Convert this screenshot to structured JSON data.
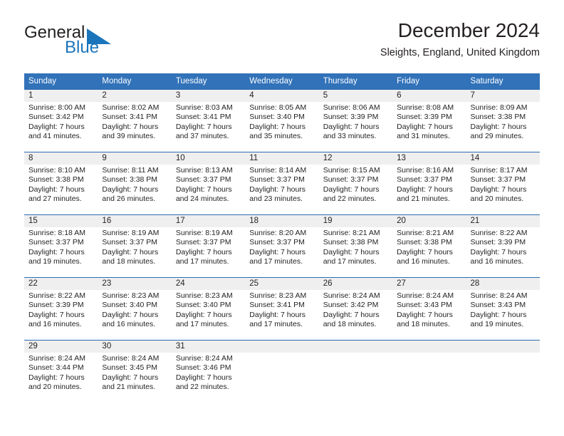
{
  "brand": {
    "name_part1": "General",
    "name_part2": "Blue",
    "accent_color": "#1b75bb"
  },
  "header": {
    "title": "December 2024",
    "subtitle": "Sleights, England, United Kingdom"
  },
  "theme": {
    "header_row_bg": "#3172b9",
    "daynum_band_bg": "#efefef",
    "rule_color": "#2a6cb3"
  },
  "weekdays": [
    "Sunday",
    "Monday",
    "Tuesday",
    "Wednesday",
    "Thursday",
    "Friday",
    "Saturday"
  ],
  "weeks": [
    [
      {
        "day": "1",
        "sunrise": "Sunrise: 8:00 AM",
        "sunset": "Sunset: 3:42 PM",
        "daylight1": "Daylight: 7 hours",
        "daylight2": "and 41 minutes."
      },
      {
        "day": "2",
        "sunrise": "Sunrise: 8:02 AM",
        "sunset": "Sunset: 3:41 PM",
        "daylight1": "Daylight: 7 hours",
        "daylight2": "and 39 minutes."
      },
      {
        "day": "3",
        "sunrise": "Sunrise: 8:03 AM",
        "sunset": "Sunset: 3:41 PM",
        "daylight1": "Daylight: 7 hours",
        "daylight2": "and 37 minutes."
      },
      {
        "day": "4",
        "sunrise": "Sunrise: 8:05 AM",
        "sunset": "Sunset: 3:40 PM",
        "daylight1": "Daylight: 7 hours",
        "daylight2": "and 35 minutes."
      },
      {
        "day": "5",
        "sunrise": "Sunrise: 8:06 AM",
        "sunset": "Sunset: 3:39 PM",
        "daylight1": "Daylight: 7 hours",
        "daylight2": "and 33 minutes."
      },
      {
        "day": "6",
        "sunrise": "Sunrise: 8:08 AM",
        "sunset": "Sunset: 3:39 PM",
        "daylight1": "Daylight: 7 hours",
        "daylight2": "and 31 minutes."
      },
      {
        "day": "7",
        "sunrise": "Sunrise: 8:09 AM",
        "sunset": "Sunset: 3:38 PM",
        "daylight1": "Daylight: 7 hours",
        "daylight2": "and 29 minutes."
      }
    ],
    [
      {
        "day": "8",
        "sunrise": "Sunrise: 8:10 AM",
        "sunset": "Sunset: 3:38 PM",
        "daylight1": "Daylight: 7 hours",
        "daylight2": "and 27 minutes."
      },
      {
        "day": "9",
        "sunrise": "Sunrise: 8:11 AM",
        "sunset": "Sunset: 3:38 PM",
        "daylight1": "Daylight: 7 hours",
        "daylight2": "and 26 minutes."
      },
      {
        "day": "10",
        "sunrise": "Sunrise: 8:13 AM",
        "sunset": "Sunset: 3:37 PM",
        "daylight1": "Daylight: 7 hours",
        "daylight2": "and 24 minutes."
      },
      {
        "day": "11",
        "sunrise": "Sunrise: 8:14 AM",
        "sunset": "Sunset: 3:37 PM",
        "daylight1": "Daylight: 7 hours",
        "daylight2": "and 23 minutes."
      },
      {
        "day": "12",
        "sunrise": "Sunrise: 8:15 AM",
        "sunset": "Sunset: 3:37 PM",
        "daylight1": "Daylight: 7 hours",
        "daylight2": "and 22 minutes."
      },
      {
        "day": "13",
        "sunrise": "Sunrise: 8:16 AM",
        "sunset": "Sunset: 3:37 PM",
        "daylight1": "Daylight: 7 hours",
        "daylight2": "and 21 minutes."
      },
      {
        "day": "14",
        "sunrise": "Sunrise: 8:17 AM",
        "sunset": "Sunset: 3:37 PM",
        "daylight1": "Daylight: 7 hours",
        "daylight2": "and 20 minutes."
      }
    ],
    [
      {
        "day": "15",
        "sunrise": "Sunrise: 8:18 AM",
        "sunset": "Sunset: 3:37 PM",
        "daylight1": "Daylight: 7 hours",
        "daylight2": "and 19 minutes."
      },
      {
        "day": "16",
        "sunrise": "Sunrise: 8:19 AM",
        "sunset": "Sunset: 3:37 PM",
        "daylight1": "Daylight: 7 hours",
        "daylight2": "and 18 minutes."
      },
      {
        "day": "17",
        "sunrise": "Sunrise: 8:19 AM",
        "sunset": "Sunset: 3:37 PM",
        "daylight1": "Daylight: 7 hours",
        "daylight2": "and 17 minutes."
      },
      {
        "day": "18",
        "sunrise": "Sunrise: 8:20 AM",
        "sunset": "Sunset: 3:37 PM",
        "daylight1": "Daylight: 7 hours",
        "daylight2": "and 17 minutes."
      },
      {
        "day": "19",
        "sunrise": "Sunrise: 8:21 AM",
        "sunset": "Sunset: 3:38 PM",
        "daylight1": "Daylight: 7 hours",
        "daylight2": "and 17 minutes."
      },
      {
        "day": "20",
        "sunrise": "Sunrise: 8:21 AM",
        "sunset": "Sunset: 3:38 PM",
        "daylight1": "Daylight: 7 hours",
        "daylight2": "and 16 minutes."
      },
      {
        "day": "21",
        "sunrise": "Sunrise: 8:22 AM",
        "sunset": "Sunset: 3:39 PM",
        "daylight1": "Daylight: 7 hours",
        "daylight2": "and 16 minutes."
      }
    ],
    [
      {
        "day": "22",
        "sunrise": "Sunrise: 8:22 AM",
        "sunset": "Sunset: 3:39 PM",
        "daylight1": "Daylight: 7 hours",
        "daylight2": "and 16 minutes."
      },
      {
        "day": "23",
        "sunrise": "Sunrise: 8:23 AM",
        "sunset": "Sunset: 3:40 PM",
        "daylight1": "Daylight: 7 hours",
        "daylight2": "and 16 minutes."
      },
      {
        "day": "24",
        "sunrise": "Sunrise: 8:23 AM",
        "sunset": "Sunset: 3:40 PM",
        "daylight1": "Daylight: 7 hours",
        "daylight2": "and 17 minutes."
      },
      {
        "day": "25",
        "sunrise": "Sunrise: 8:23 AM",
        "sunset": "Sunset: 3:41 PM",
        "daylight1": "Daylight: 7 hours",
        "daylight2": "and 17 minutes."
      },
      {
        "day": "26",
        "sunrise": "Sunrise: 8:24 AM",
        "sunset": "Sunset: 3:42 PM",
        "daylight1": "Daylight: 7 hours",
        "daylight2": "and 18 minutes."
      },
      {
        "day": "27",
        "sunrise": "Sunrise: 8:24 AM",
        "sunset": "Sunset: 3:43 PM",
        "daylight1": "Daylight: 7 hours",
        "daylight2": "and 18 minutes."
      },
      {
        "day": "28",
        "sunrise": "Sunrise: 8:24 AM",
        "sunset": "Sunset: 3:43 PM",
        "daylight1": "Daylight: 7 hours",
        "daylight2": "and 19 minutes."
      }
    ],
    [
      {
        "day": "29",
        "sunrise": "Sunrise: 8:24 AM",
        "sunset": "Sunset: 3:44 PM",
        "daylight1": "Daylight: 7 hours",
        "daylight2": "and 20 minutes."
      },
      {
        "day": "30",
        "sunrise": "Sunrise: 8:24 AM",
        "sunset": "Sunset: 3:45 PM",
        "daylight1": "Daylight: 7 hours",
        "daylight2": "and 21 minutes."
      },
      {
        "day": "31",
        "sunrise": "Sunrise: 8:24 AM",
        "sunset": "Sunset: 3:46 PM",
        "daylight1": "Daylight: 7 hours",
        "daylight2": "and 22 minutes."
      },
      {
        "day": "",
        "sunrise": "",
        "sunset": "",
        "daylight1": "",
        "daylight2": ""
      },
      {
        "day": "",
        "sunrise": "",
        "sunset": "",
        "daylight1": "",
        "daylight2": ""
      },
      {
        "day": "",
        "sunrise": "",
        "sunset": "",
        "daylight1": "",
        "daylight2": ""
      },
      {
        "day": "",
        "sunrise": "",
        "sunset": "",
        "daylight1": "",
        "daylight2": ""
      }
    ]
  ]
}
